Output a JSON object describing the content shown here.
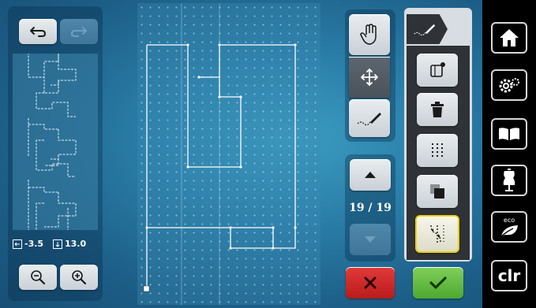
{
  "preview": {
    "x_label": "-3.5",
    "y_label": "13.0"
  },
  "nav": {
    "position_label": "19 / 19"
  },
  "sidebar": {
    "clr_label": "clr",
    "eco_label": "eco"
  },
  "icons": {
    "undo": "undo-icon",
    "redo": "redo-icon",
    "zoom_out": "zoom-out-icon",
    "zoom_in": "zoom-in-icon",
    "hand": "hand-icon",
    "move": "move-arrows-icon",
    "stitch": "stitch-pen-icon",
    "up": "arrow-up-icon",
    "down": "arrow-down-icon",
    "cancel": "x-icon",
    "confirm": "checkmark-icon",
    "home": "home-icon",
    "settings": "gears-icon",
    "tutorial": "book-icon",
    "dress": "dress-form-icon",
    "eco": "eco-leaf-icon"
  },
  "colors": {
    "cancel": "#d22a2a",
    "confirm": "#5fbd3c",
    "highlight": "#f0d000"
  }
}
